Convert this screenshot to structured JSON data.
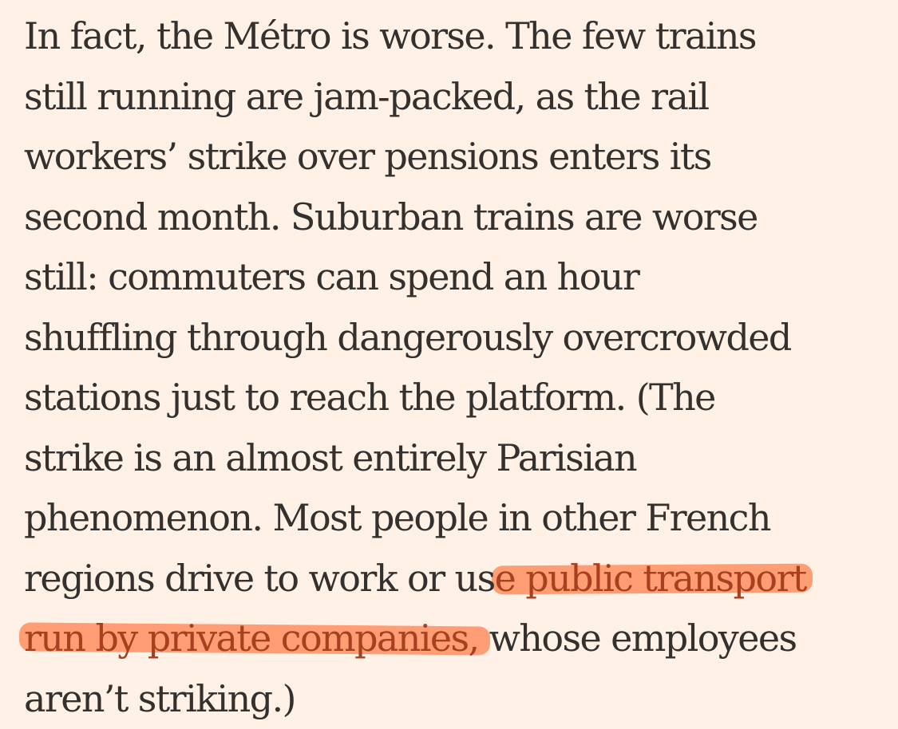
{
  "article": {
    "lines": [
      "In fact, the Métro is worse. The few trains",
      "still running are jam-packed, as the rail",
      "workers’ strike over pensions enters its",
      "second month. Suburban trains are worse",
      "still: commuters can spend an hour",
      "shuffling through dangerously overcrowded",
      "stations just to reach the platform. (The",
      "strike is an almost entirely Parisian",
      "phenomenon. Most people in other French"
    ],
    "line10_pre": "regions drive to work or us",
    "line10_hl": "e public transport",
    "line11_hl": "run by private companies,",
    "line11_post": " whose employees",
    "line12": "aren’t striking.)",
    "highlight_color": "#ff8a5c"
  }
}
